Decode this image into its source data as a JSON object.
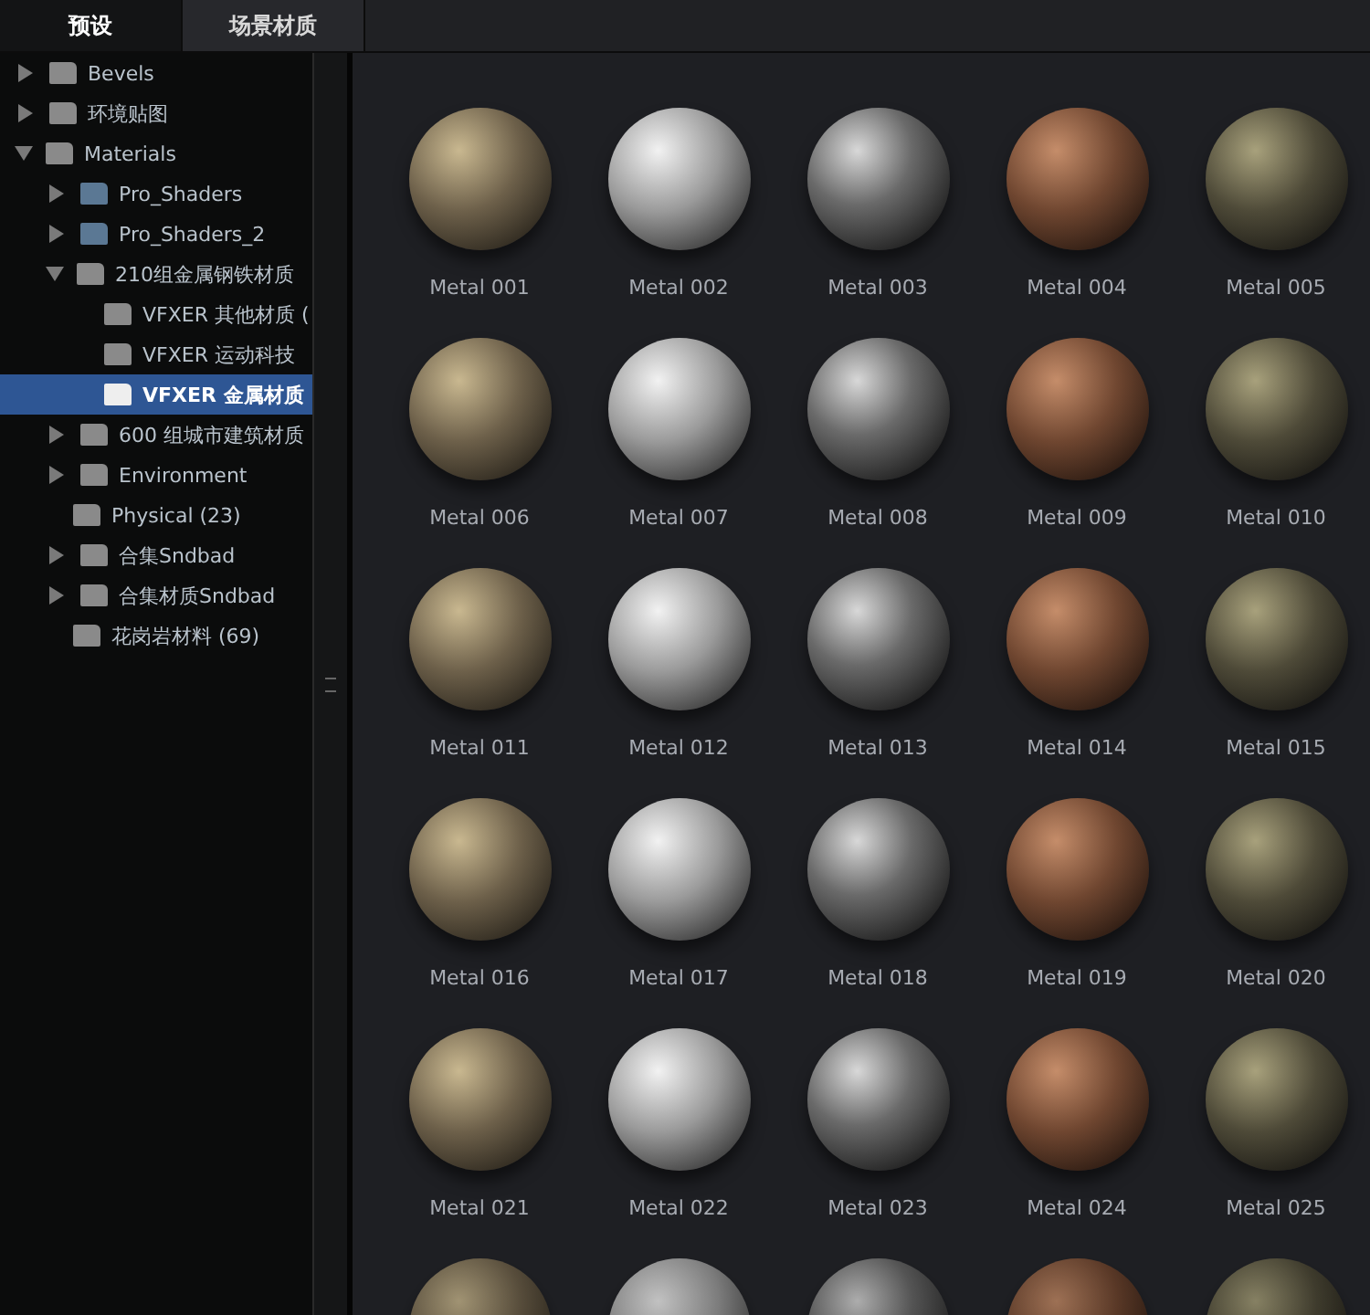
{
  "tabs": [
    {
      "label": "预设",
      "selected": true
    },
    {
      "label": "场景材质",
      "selected": false
    }
  ],
  "tree": [
    {
      "label": "Bevels",
      "expanded": false,
      "selected": false,
      "color": "#8a8a8a"
    },
    {
      "label": "环境贴图",
      "expanded": false,
      "selected": false,
      "color": "#8a8a8a"
    },
    {
      "label": "Materials",
      "expanded": true,
      "selected": false,
      "color": "#8a8a8a",
      "children": [
        {
          "label": "Pro_Shaders",
          "expanded": false,
          "selected": false,
          "color": "#5b7894"
        },
        {
          "label": "Pro_Shaders_2",
          "expanded": false,
          "selected": false,
          "color": "#5b7894"
        },
        {
          "label": "210组金属钢铁材质",
          "expanded": true,
          "selected": false,
          "color": "#8a8a8a",
          "children": [
            {
              "label": "VFXER 其他材质 (",
              "selected": false,
              "color": "#8a8a8a"
            },
            {
              "label": "VFXER 运动科技",
              "selected": false,
              "color": "#8a8a8a"
            },
            {
              "label": "VFXER 金属材质",
              "selected": true,
              "color": "#eeeeee"
            }
          ]
        },
        {
          "label": "600 组城市建筑材质",
          "expanded": false,
          "selected": false,
          "color": "#8a8a8a"
        },
        {
          "label": "Environment",
          "expanded": false,
          "selected": false,
          "color": "#8a8a8a"
        },
        {
          "label": "Physical (23)",
          "selected": false,
          "color": "#8a8a8a"
        },
        {
          "label": "合集Sndbad",
          "expanded": false,
          "selected": false,
          "color": "#8a8a8a"
        },
        {
          "label": "合集材质Sndbad",
          "expanded": false,
          "selected": false,
          "color": "#8a8a8a"
        },
        {
          "label": "花岗岩材料 (69)",
          "selected": false,
          "color": "#8a8a8a"
        }
      ]
    }
  ],
  "materials": [
    {
      "label": "Metal 001"
    },
    {
      "label": "Metal 002"
    },
    {
      "label": "Metal 003"
    },
    {
      "label": "Metal 004"
    },
    {
      "label": "Metal 005"
    },
    {
      "label": "Metal 006"
    },
    {
      "label": "Metal 007"
    },
    {
      "label": "Metal 008"
    },
    {
      "label": "Metal 009"
    },
    {
      "label": "Metal 010"
    },
    {
      "label": "Metal 011"
    },
    {
      "label": "Metal 012"
    },
    {
      "label": "Metal 013"
    },
    {
      "label": "Metal 014"
    },
    {
      "label": "Metal 015"
    },
    {
      "label": "Metal 016"
    },
    {
      "label": "Metal 017"
    },
    {
      "label": "Metal 018"
    },
    {
      "label": "Metal 019"
    },
    {
      "label": "Metal 020"
    },
    {
      "label": "Metal 021"
    },
    {
      "label": "Metal 022"
    },
    {
      "label": "Metal 023"
    },
    {
      "label": "Metal 024"
    },
    {
      "label": "Metal 025"
    },
    {
      "kind": "cut-off"
    },
    {
      "kind": "cut-off"
    },
    {
      "kind": "cut-off"
    },
    {
      "kind": "cut-off"
    },
    {
      "kind": "cut-off"
    }
  ]
}
